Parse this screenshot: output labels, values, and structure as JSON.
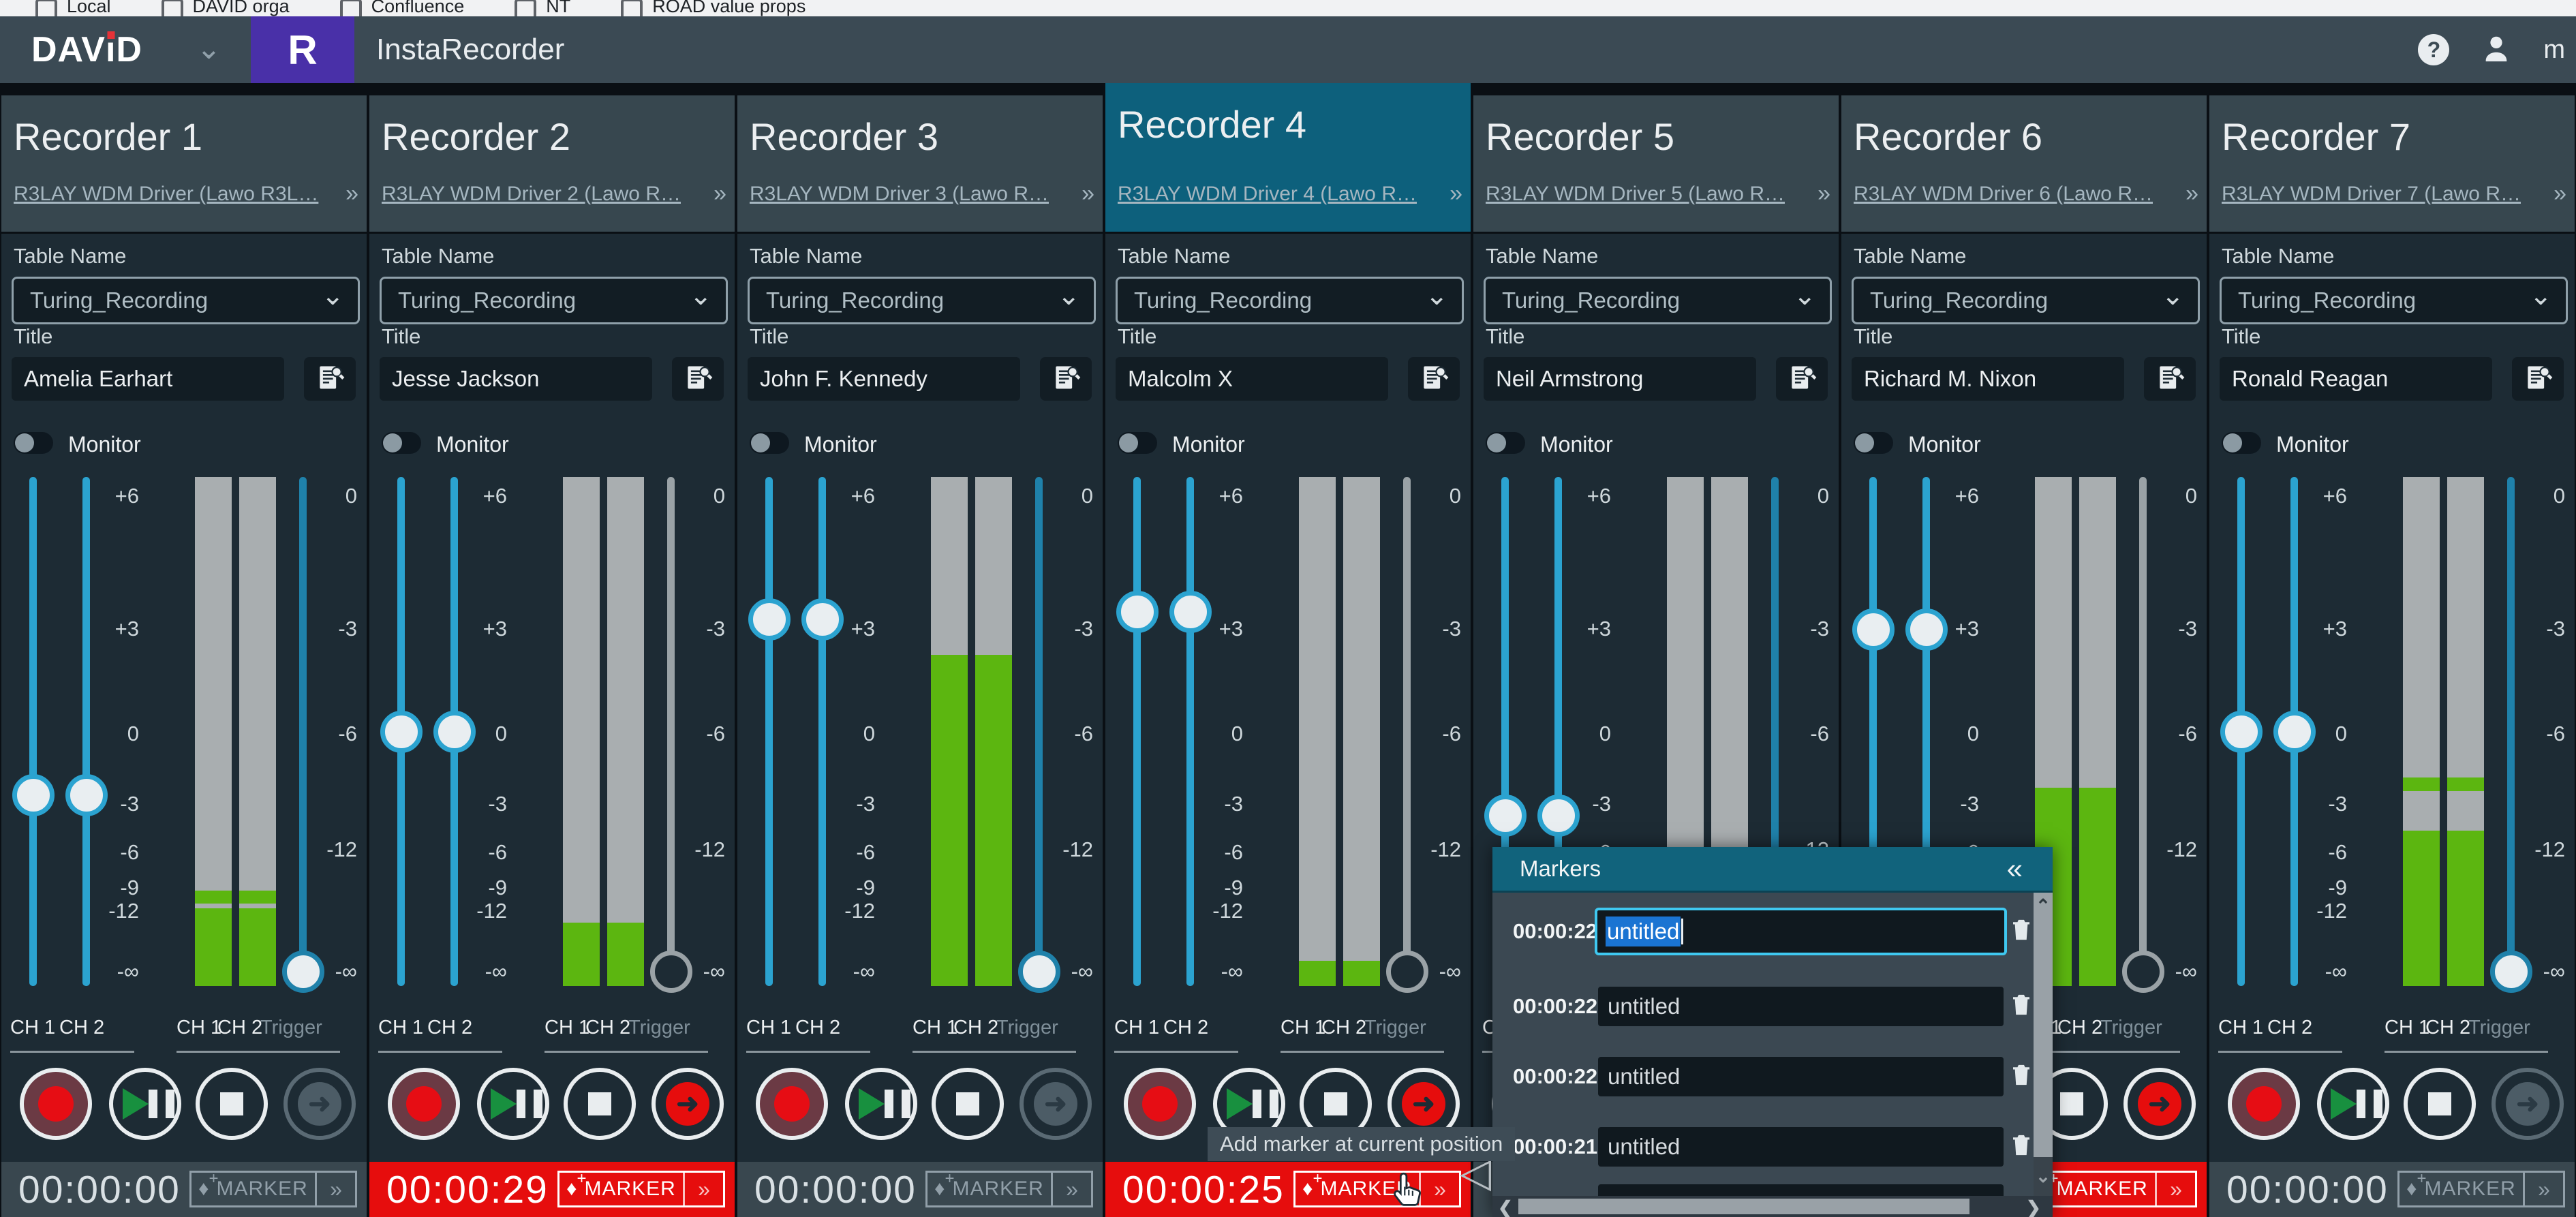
{
  "browser": {
    "bookmarks": [
      "Local",
      "DAVID orga",
      "Confluence",
      "NT",
      "ROAD value props"
    ]
  },
  "header": {
    "brand_prefix": "DAV",
    "brand_i": "ı",
    "brand_suffix": "D",
    "logo_letter": "R",
    "app_title": "InstaRecorder",
    "user_initial": "m"
  },
  "shared": {
    "table_label": "Table Name",
    "title_label": "Title",
    "monitor_label": "Monitor",
    "marker_label": "MARKER",
    "ch1": "CH 1",
    "ch2": "CH 2",
    "trigger": "Trigger",
    "icons": {
      "chevron_down": "⌄",
      "more": "»",
      "collapse": "«",
      "diamond": "♦",
      "plus": "+",
      "help": "?",
      "arrow_right": "➜",
      "handle_left": "◁",
      "scroll_up": "⌃",
      "scroll_down": "⌄",
      "scroll_left": "❮",
      "scroll_right": "❯"
    }
  },
  "meter_scale": {
    "left": [
      {
        "label": "+6",
        "pct": 3.7
      },
      {
        "label": "+3",
        "pct": 29.9
      },
      {
        "label": "0",
        "pct": 50.5
      },
      {
        "label": "-3",
        "pct": 64.2
      },
      {
        "label": "-6",
        "pct": 73.8
      },
      {
        "label": "-9",
        "pct": 80.7
      },
      {
        "label": "-12",
        "pct": 85.3
      },
      {
        "label": "-∞",
        "pct": 97.2
      }
    ],
    "right": [
      {
        "label": "0",
        "pct": 3.7
      },
      {
        "label": "-3",
        "pct": 29.9
      },
      {
        "label": "-6",
        "pct": 50.5
      },
      {
        "label": "-12",
        "pct": 73.2
      },
      {
        "label": "-∞",
        "pct": 97.2
      }
    ]
  },
  "recorders": [
    {
      "name": "Recorder 1",
      "driver": "R3LAY WDM Driver (Lawo R3L…",
      "table_value": "Turing_Recording",
      "title_value": "Amelia Earhart",
      "timecode": "00:00:00",
      "state": {
        "selected": false,
        "recording": false,
        "fader_pct": 62.5,
        "trigger_pct": 97.2,
        "meter": {
          "green_from": 81.2,
          "peak_line": 83.8
        }
      }
    },
    {
      "name": "Recorder 2",
      "driver": "R3LAY WDM Driver 2 (Lawo R…",
      "table_value": "Turing_Recording",
      "title_value": "Jesse Jackson",
      "timecode": "00:00:29",
      "state": {
        "selected": false,
        "recording": true,
        "fader_pct": 50,
        "trigger_pct": 97.2,
        "meter": {
          "green_from": 87.5
        }
      }
    },
    {
      "name": "Recorder 3",
      "driver": "R3LAY WDM Driver 3 (Lawo R…",
      "table_value": "Turing_Recording",
      "title_value": "John F. Kennedy",
      "timecode": "00:00:00",
      "state": {
        "selected": false,
        "recording": false,
        "fader_pct": 28,
        "trigger_pct": 97.2,
        "meter": {
          "green_from": 35
        }
      }
    },
    {
      "name": "Recorder 4",
      "driver": "R3LAY WDM Driver 4 (Lawo R…",
      "table_value": "Turing_Recording",
      "title_value": "Malcolm X",
      "timecode": "00:00:25",
      "state": {
        "selected": true,
        "recording": true,
        "fader_pct": 26.5,
        "trigger_pct": 97.2,
        "meter": {
          "green_from": 95
        }
      }
    },
    {
      "name": "Recorder 5",
      "driver": "R3LAY WDM Driver 5 (Lawo R…",
      "table_value": "Turing_Recording",
      "title_value": "Neil Armstrong",
      "timecode": "",
      "state": {
        "selected": false,
        "recording": false,
        "fader_pct": 66.5,
        "trigger_pct": 97.2,
        "meter": {
          "green_from": 100
        }
      }
    },
    {
      "name": "Recorder 6",
      "driver": "R3LAY WDM Driver 6 (Lawo R…",
      "table_value": "Turing_Recording",
      "title_value": "Richard M. Nixon",
      "timecode": "",
      "state": {
        "selected": false,
        "recording": true,
        "fader_pct": 30,
        "trigger_pct": 97.2,
        "meter": {
          "green_from": 61
        }
      }
    },
    {
      "name": "Recorder 7",
      "driver": "R3LAY WDM Driver 7 (Lawo R…",
      "table_value": "Turing_Recording",
      "title_value": "Ronald Reagan",
      "timecode": "00:00:00",
      "state": {
        "selected": false,
        "recording": false,
        "fader_pct": 50,
        "trigger_pct": 97.2,
        "meter": {
          "green_from": 69.5,
          "peak_block": [
            59,
            61.7
          ]
        }
      }
    }
  ],
  "markers_panel": {
    "title": "Markers",
    "rows": [
      {
        "time": "00:00:22",
        "name": "untitled",
        "focused": true
      },
      {
        "time": "00:00:22",
        "name": "untitled"
      },
      {
        "time": "00:00:22",
        "name": "untitled"
      },
      {
        "time": "00:00:21",
        "name": "untitled"
      }
    ]
  },
  "tooltip": {
    "text": "Add marker at current position"
  },
  "colors": {
    "accent_blue": "#2ba3d0",
    "trigger_blue": "#1f81aa",
    "record_red": "#e60d0d",
    "meter_green": "#5cb610",
    "meter_gray": "#a9aeb0",
    "selected_teal": "#0d607c",
    "panel_header": "#37474f",
    "panel_body": "#1d2b34",
    "brand_purple": "#4930a8",
    "selection_blue": "#1a74d2",
    "focus_teal": "#3fc8f0"
  }
}
